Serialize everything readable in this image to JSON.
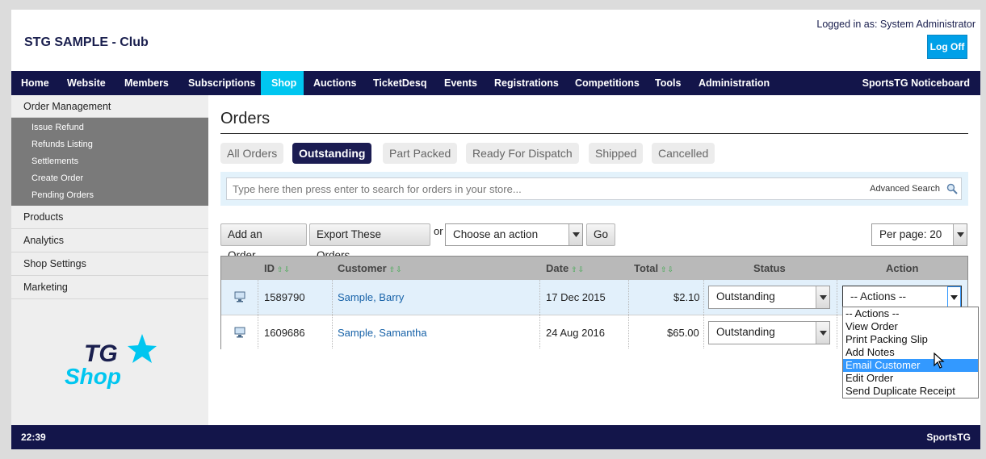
{
  "header": {
    "club_name": "STG SAMPLE - Club",
    "logged_in": "Logged in as: System Administrator",
    "logoff_label": "Log Off"
  },
  "nav": {
    "items": [
      "Home",
      "Website",
      "Members",
      "Subscriptions",
      "Shop",
      "Auctions",
      "TicketDesq",
      "Events",
      "Registrations",
      "Competitions",
      "Tools",
      "Administration"
    ],
    "active": "Shop",
    "right": "SportsTG Noticeboard",
    "active_color": "#00c6f0",
    "bar_color": "#13154a"
  },
  "sidebar": {
    "header": "Order Management",
    "subitems": [
      "Issue Refund",
      "Refunds Listing",
      "Settlements",
      "Create Order",
      "Pending Orders"
    ],
    "links": [
      "Products",
      "Analytics",
      "Shop Settings",
      "Marketing"
    ],
    "logo": {
      "line1": "TG",
      "line2": "Shop"
    }
  },
  "content": {
    "title": "Orders",
    "tabs": [
      "All Orders",
      "Outstanding",
      "Part Packed",
      "Ready For Dispatch",
      "Shipped",
      "Cancelled"
    ],
    "active_tab": "Outstanding",
    "search": {
      "placeholder": "Type here then press enter to search for orders in your store...",
      "value": "",
      "advanced": "Advanced Search"
    },
    "toolbar": {
      "add_label": "Add an Order...",
      "export_label": "Export These Orders...",
      "or_label": "or",
      "action_select": "Choose an action",
      "go_label": "Go",
      "per_page": "Per page: 20"
    },
    "table": {
      "columns": [
        "ID",
        "Customer",
        "Date",
        "Total",
        "Status",
        "Action"
      ],
      "rows": [
        {
          "id": "1589790",
          "customer": "Sample, Barry",
          "date": "17 Dec 2015",
          "total": "$2.10",
          "status": "Outstanding",
          "action": "-- Actions --"
        },
        {
          "id": "1609686",
          "customer": "Sample, Samantha",
          "date": "24 Aug 2016",
          "total": "$65.00",
          "status": "Outstanding",
          "action": ""
        }
      ]
    },
    "actions_dropdown": {
      "options": [
        "-- Actions --",
        "View Order",
        "Print Packing Slip",
        "Add Notes",
        "Email Customer",
        "Edit Order",
        "Send Duplicate Receipt"
      ],
      "highlighted": "Email Customer"
    }
  },
  "footer": {
    "time": "22:39",
    "brand": "SportsTG"
  }
}
